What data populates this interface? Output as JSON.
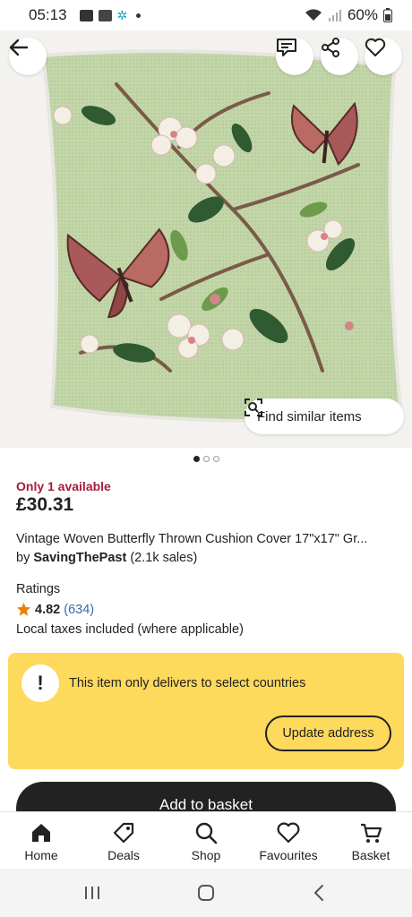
{
  "status_bar": {
    "time": "05:13",
    "battery": "60%"
  },
  "image": {
    "pager_count": 3,
    "pager_active": 0,
    "find_similar_label": "Find similar items"
  },
  "listing": {
    "availability": "Only 1 available",
    "price": "£30.31",
    "title": "Vintage Woven Butterfly Thrown Cushion Cover 17\"x17\" Gr...",
    "by_prefix": "by",
    "seller": "SavingThePast",
    "sales": "(2.1k sales)",
    "ratings_label": "Ratings",
    "rating": "4.82",
    "rating_count": "(634)",
    "taxes": "Local taxes included (where applicable)"
  },
  "notice": {
    "icon_symbol": "!",
    "text": "This item only delivers to select countries",
    "button": "Update address"
  },
  "cta": {
    "add_to_basket": "Add to basket"
  },
  "nav": [
    {
      "label": "Home",
      "icon": "home-icon"
    },
    {
      "label": "Deals",
      "icon": "tag-icon"
    },
    {
      "label": "Shop",
      "icon": "search-icon"
    },
    {
      "label": "Favourites",
      "icon": "heart-icon"
    },
    {
      "label": "Basket",
      "icon": "basket-icon"
    }
  ],
  "colors": {
    "accent_red": "#a61a3d",
    "notice_yellow": "#fdd95c",
    "link_blue": "#3b6aa8",
    "star": "#e7820b",
    "cushion_green": "#bfd3a4"
  }
}
